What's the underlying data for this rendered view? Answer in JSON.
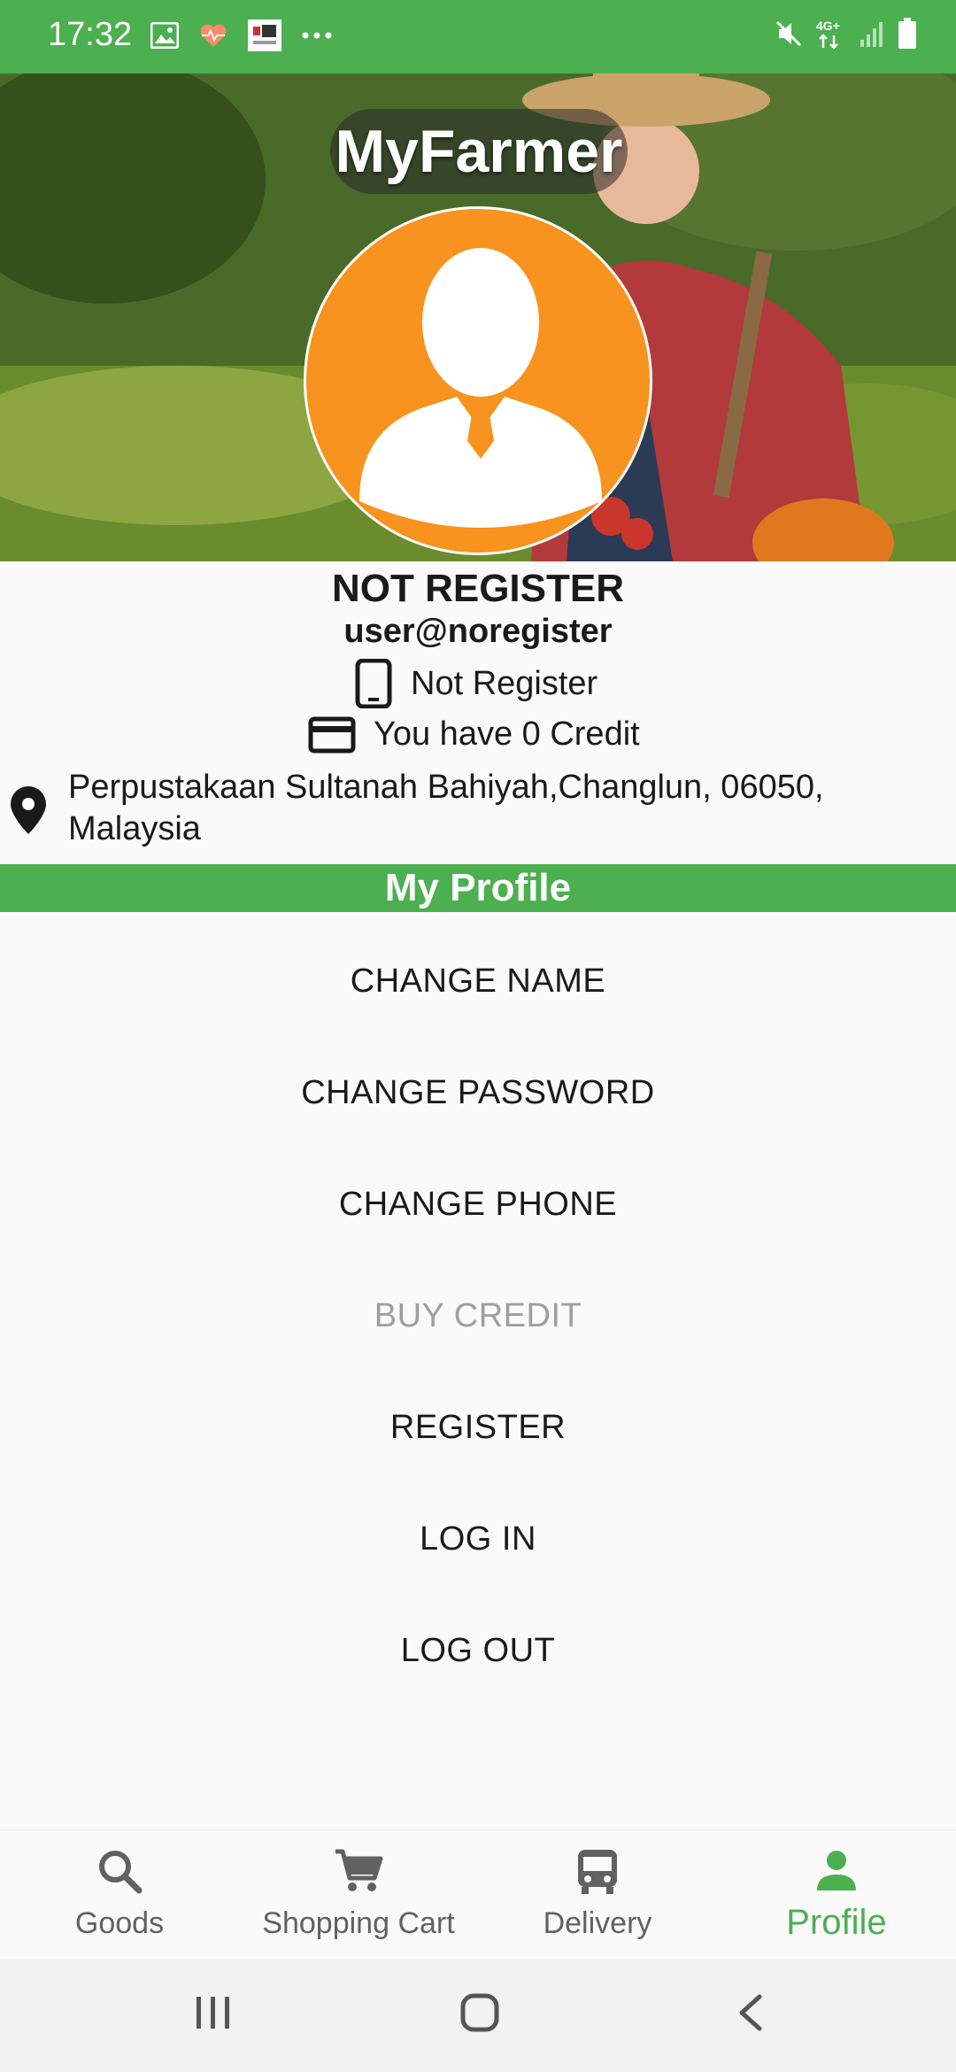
{
  "status_bar": {
    "time": "17:32",
    "left_icons": [
      "image-icon",
      "heart-rate-icon",
      "app-notification-icon",
      "more-dots-icon"
    ],
    "right_icons": [
      "mute-icon",
      "4g-signal-icon",
      "signal-bars-icon",
      "battery-icon"
    ],
    "network": "4G+"
  },
  "header": {
    "app_title": "MyFarmer"
  },
  "profile": {
    "name": "NOT REGISTER",
    "email": "user@noregister",
    "phone": "Not Register",
    "credit": "You have 0 Credit",
    "address": "Perpustakaan Sultanah Bahiyah,Changlun, 06050, Malaysia"
  },
  "section": {
    "title": "My Profile"
  },
  "menu": {
    "change_name": "CHANGE NAME",
    "change_password": "CHANGE PASSWORD",
    "change_phone": "CHANGE PHONE",
    "buy_credit": "BUY CREDIT",
    "register": "REGISTER",
    "log_in": "LOG IN",
    "log_out": "LOG OUT"
  },
  "bottom_nav": {
    "goods": "Goods",
    "cart": "Shopping Cart",
    "delivery": "Delivery",
    "profile": "Profile",
    "active": "profile"
  },
  "colors": {
    "primary": "#4caf50",
    "avatar_bg": "#f7931e",
    "disabled_text": "#9e9e9e"
  }
}
